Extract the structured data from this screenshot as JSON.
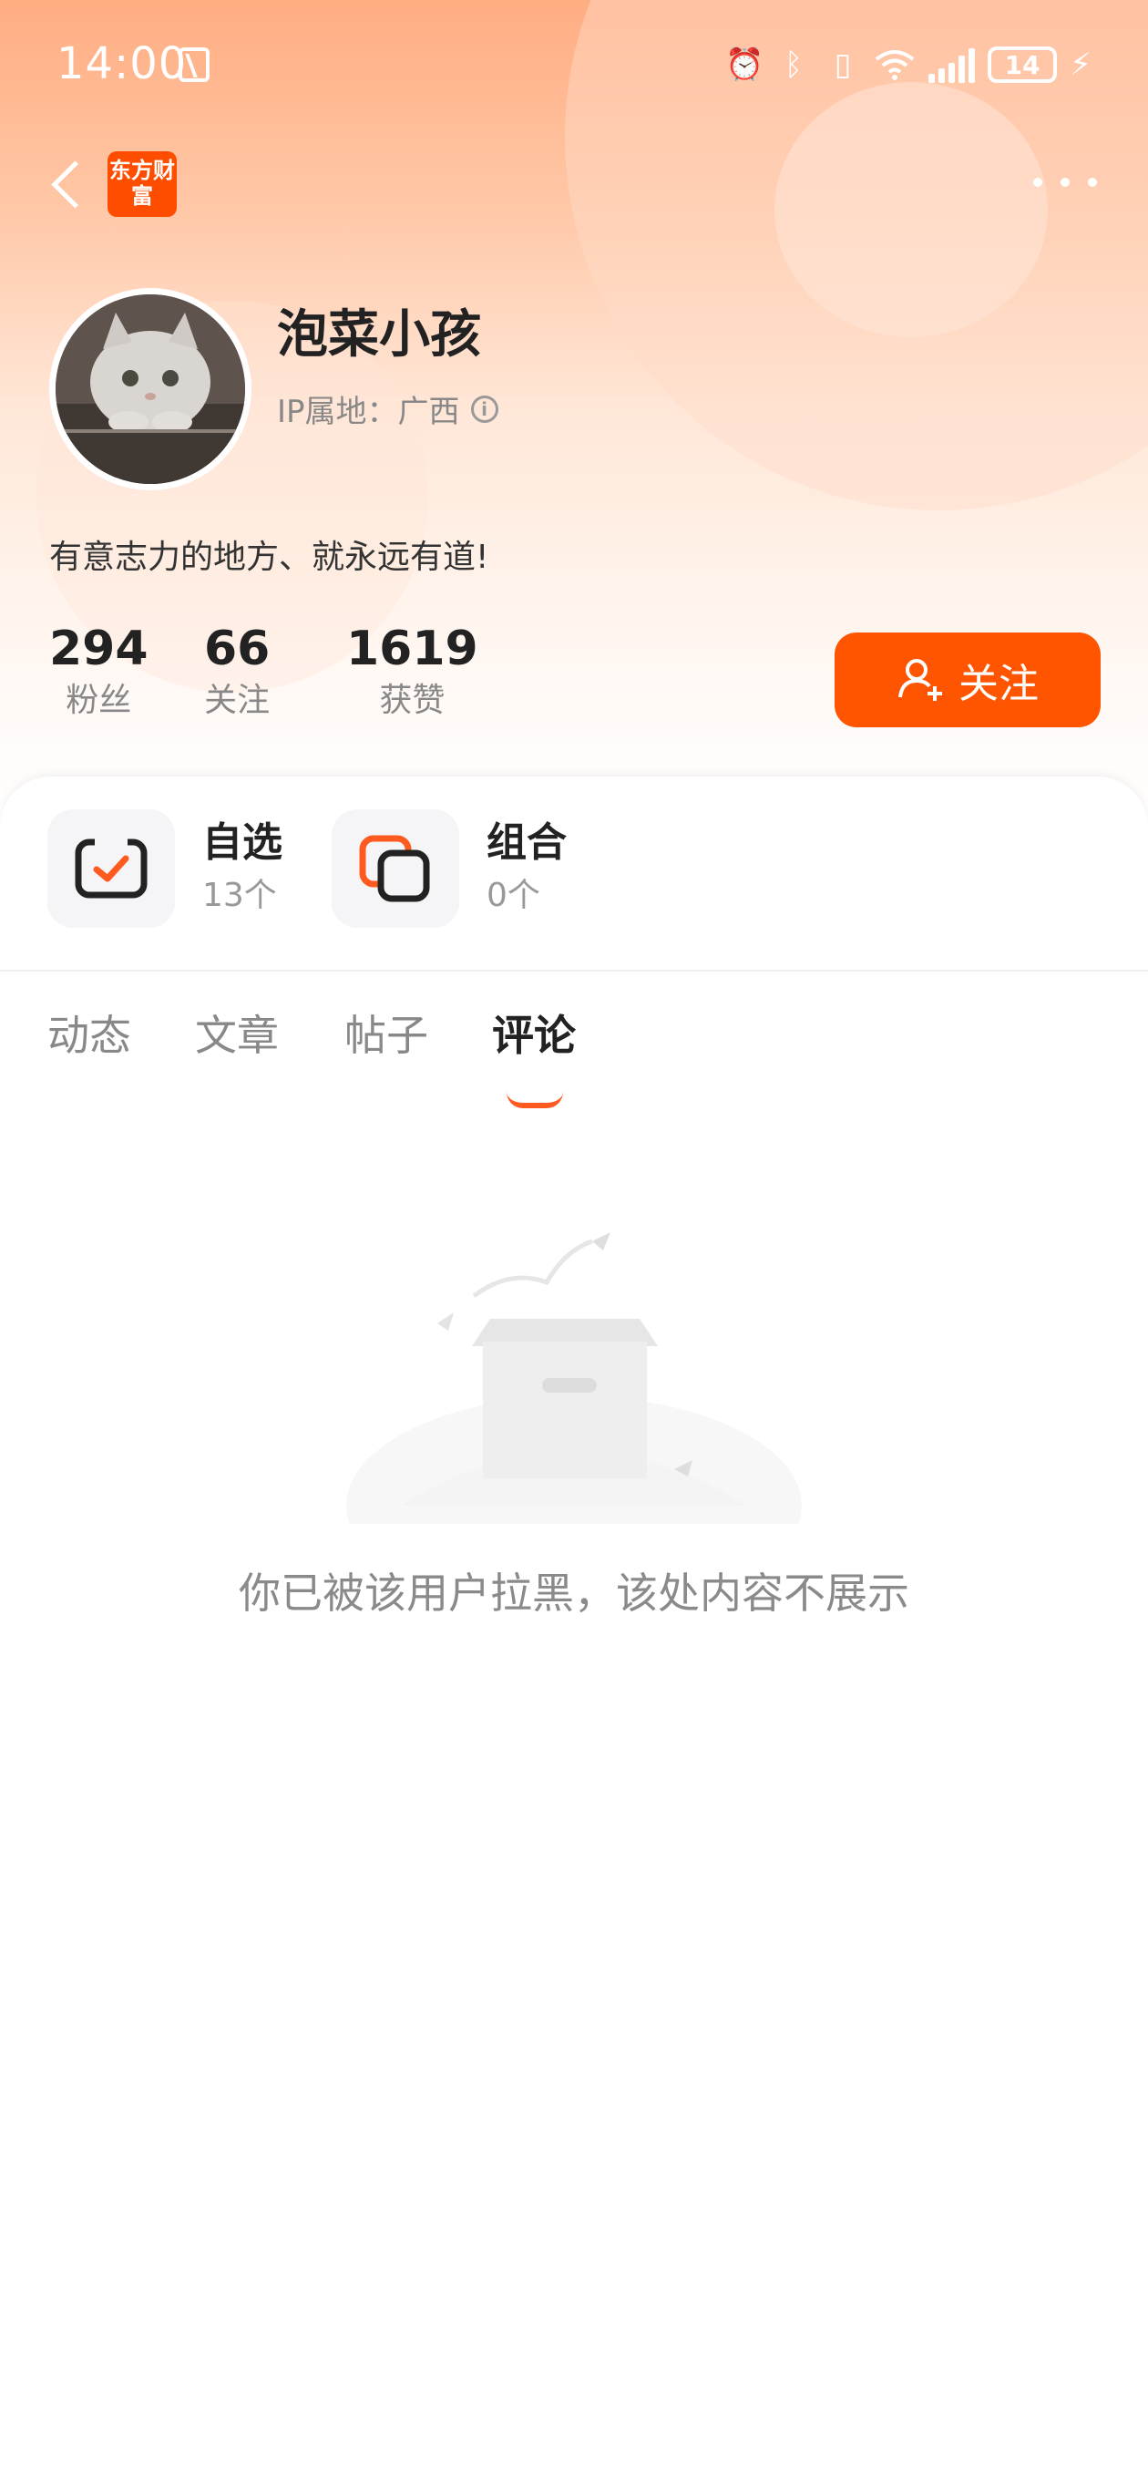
{
  "status_bar": {
    "time": "14:00",
    "battery": "14",
    "icons": [
      "nfc-icon",
      "alarm-icon",
      "bluetooth-icon",
      "vibrate-icon",
      "wifi-icon",
      "signal-icon",
      "battery-icon",
      "charging-icon"
    ]
  },
  "nav": {
    "logo_text": "东方财富",
    "back_icon": "back-arrow-icon",
    "more_icon": "more-icon"
  },
  "profile": {
    "username": "泡菜小孩",
    "ip_location": "IP属地：广西",
    "bio": "有意志力的地方、就永远有道!",
    "stats": [
      {
        "value": "294",
        "label": "粉丝"
      },
      {
        "value": "66",
        "label": "关注"
      },
      {
        "value": "1619",
        "label": "获赞"
      }
    ],
    "follow_button": "关注"
  },
  "quick_links": [
    {
      "title": "自选",
      "count": "13个",
      "icon": "watchlist-icon"
    },
    {
      "title": "组合",
      "count": "0个",
      "icon": "portfolio-icon"
    }
  ],
  "tabs": {
    "items": [
      "动态",
      "文章",
      "帖子",
      "评论"
    ],
    "active": "评论"
  },
  "empty_state": {
    "message": "你已被该用户拉黑，该处内容不展示",
    "icon": "empty-box-icon"
  },
  "colors": {
    "accent": "#ff5500",
    "header_gradient_top": "#ffad82",
    "text_primary": "#222222",
    "text_secondary": "#888888"
  }
}
